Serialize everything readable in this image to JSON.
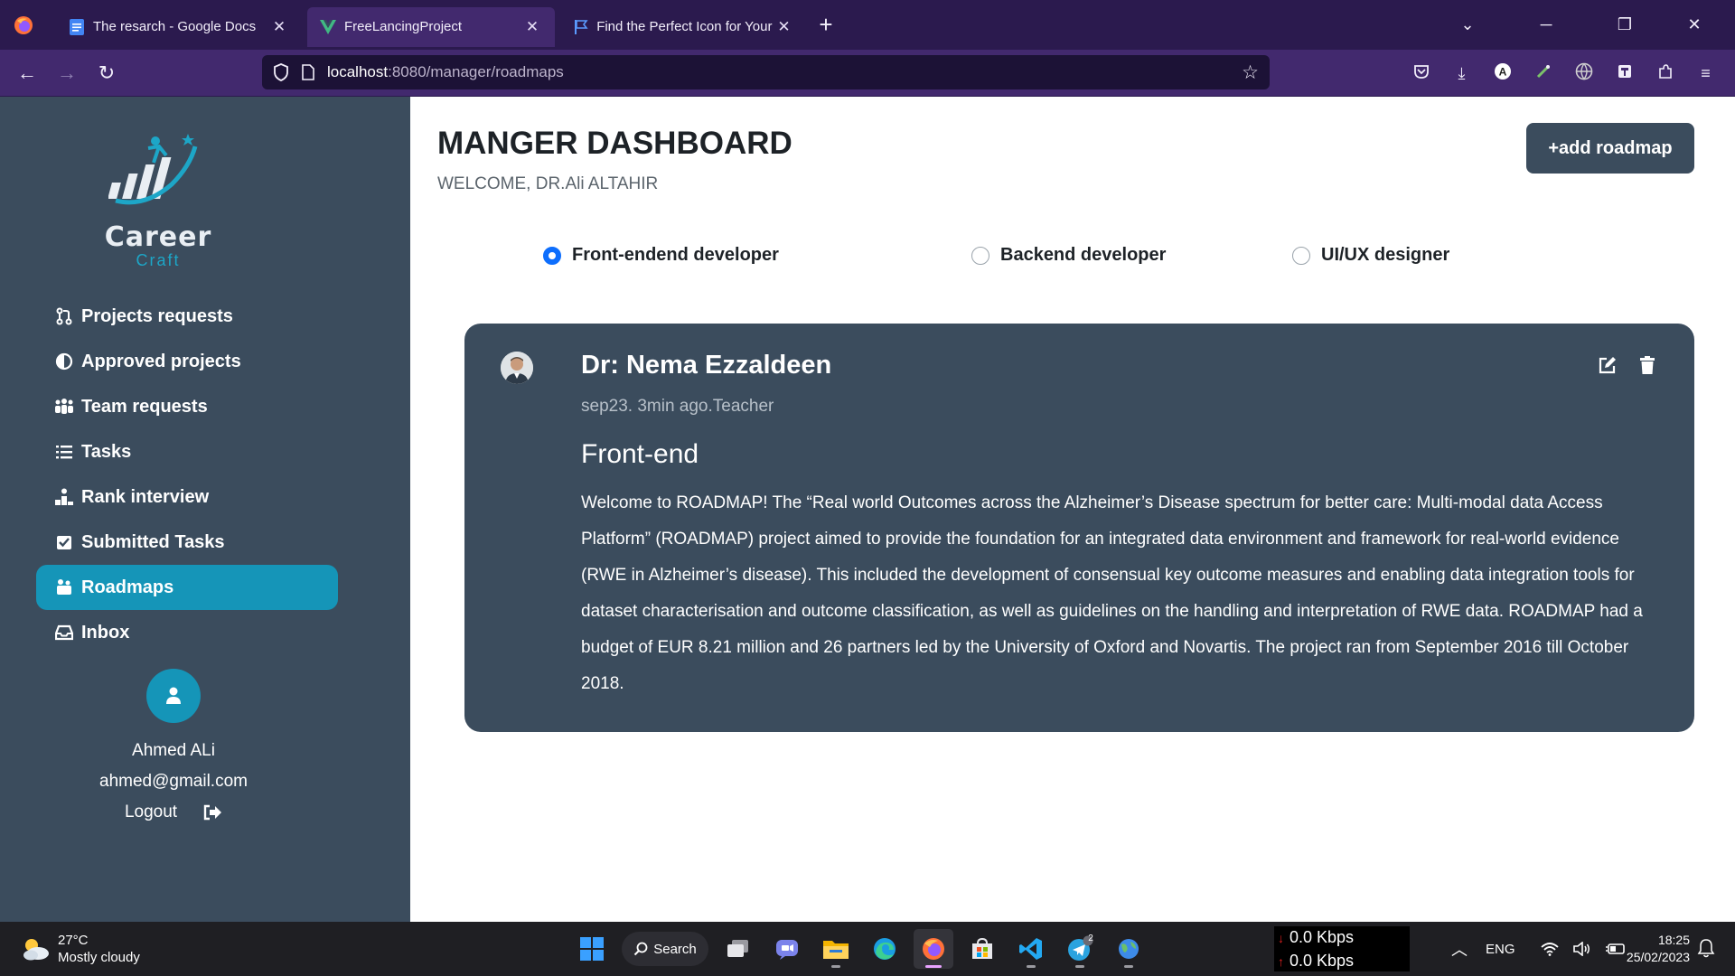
{
  "browser": {
    "tabs": [
      {
        "title": "The resarch - Google Docs",
        "active": false
      },
      {
        "title": "FreeLancingProject",
        "active": true
      },
      {
        "title": "Find the Perfect Icon for Your Pr",
        "active": false
      }
    ],
    "url_host": "localhost",
    "url_path": ":8080/manager/roadmaps"
  },
  "sidebar": {
    "brand_word": "Career",
    "brand_sub": "Craft",
    "items": [
      {
        "label": "Projects requests",
        "icon": "pull-request-icon"
      },
      {
        "label": "Approved projects",
        "icon": "half-circle-icon"
      },
      {
        "label": "Team requests",
        "icon": "team-icon"
      },
      {
        "label": "Tasks",
        "icon": "list-icon"
      },
      {
        "label": "Rank interview",
        "icon": "ranking-icon"
      },
      {
        "label": "Submitted Tasks",
        "icon": "checked-box-icon"
      },
      {
        "label": "Roadmaps",
        "icon": "roadmap-icon",
        "active": true
      },
      {
        "label": "Inbox",
        "icon": "inbox-icon"
      }
    ],
    "user": {
      "name": "Ahmed ALi",
      "email": "ahmed@gmail.com",
      "logout_label": "Logout"
    }
  },
  "main": {
    "title": "MANGER DASHBOARD",
    "welcome": "WELCOME, DR.Ali ALTAHIR",
    "add_button": "+add roadmap",
    "radios": [
      {
        "label": "Front-endend developer",
        "checked": true
      },
      {
        "label": "Backend developer",
        "checked": false
      },
      {
        "label": "UI/UX designer",
        "checked": false
      }
    ],
    "card": {
      "author": "Dr: Nema Ezzaldeen",
      "meta": "sep23. 3min ago.Teacher",
      "heading": "Front-end",
      "body": "Welcome to ROADMAP! The “Real world Outcomes across the Alzheimer’s Disease spectrum for better care: Multi-modal data Access Platform” (ROADMAP) project aimed to provide the foundation for an integrated data environment and framework for real-world evidence (RWE in Alzheimer’s disease). This included the development of consensual key outcome measures and enabling data integration tools for dataset characterisation and outcome classification, as well as guidelines on the handling and interpretation of RWE data. ROADMAP had a budget of EUR 8.21 million and 26 partners led by the University of Oxford and Novartis. The project ran from September 2016 till October 2018."
    }
  },
  "taskbar": {
    "weather_temp": "27°C",
    "weather_desc": "Mostly cloudy",
    "search_label": "Search",
    "telegram_badge": "2",
    "net_down": "0.0 Kbps",
    "net_up": "0.0 Kbps",
    "lang": "ENG",
    "time": "18:25",
    "date": "25/02/2023"
  },
  "colors": {
    "browser_tabbar": "#2b1a4e",
    "browser_navbar": "#42296e",
    "sidebar_bg": "#3b4c5d",
    "accent": "#1595b8",
    "radio_checked": "#0d6efd",
    "card_bg": "#3b4c5d"
  }
}
